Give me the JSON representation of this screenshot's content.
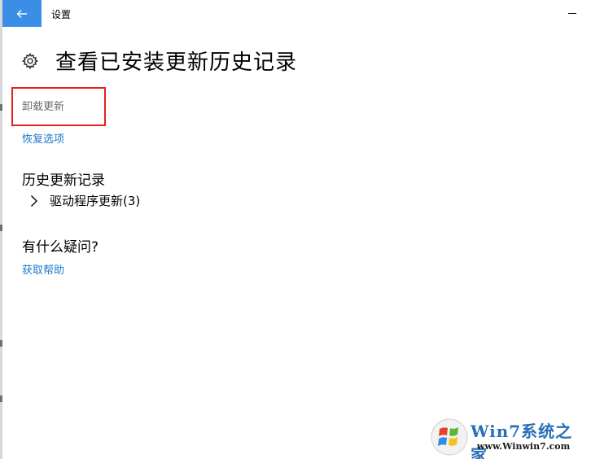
{
  "window": {
    "title": "设置",
    "back_icon": "arrow-left-icon",
    "minimize_icon": "minimize-icon",
    "accent_color": "#3a8ee6"
  },
  "header": {
    "icon": "gear-icon",
    "title": "查看已安装更新历史记录"
  },
  "actions": {
    "uninstall_label": "卸载更新",
    "recovery_label": "恢复选项",
    "highlight_color": "#e8201b",
    "link_color": "#1e78c8"
  },
  "history": {
    "heading": "历史更新记录",
    "items": [
      {
        "label": "驱动程序更新(3)",
        "icon": "chevron-right-icon"
      }
    ]
  },
  "help": {
    "heading": "有什么疑问?",
    "link_label": "获取帮助"
  },
  "watermark": {
    "title": "Win7系统之家",
    "url": "www.Winwin7.com"
  }
}
